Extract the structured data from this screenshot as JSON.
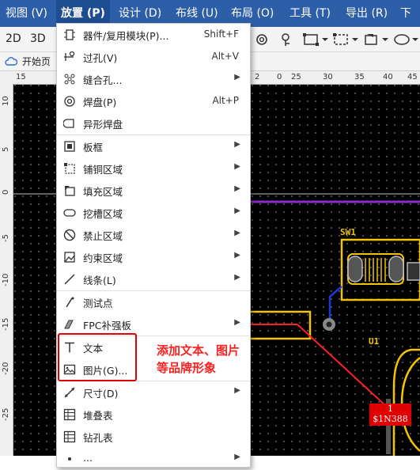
{
  "menubar": {
    "items": [
      "视图 (V)",
      "放置 (P)",
      "设计 (D)",
      "布线 (U)",
      "布局 (O)",
      "工具 (T)",
      "导出 (R)",
      "下"
    ]
  },
  "toolbar": {
    "view2d": "2D",
    "view3d": "3D"
  },
  "tabbar": {
    "home_tab": "开始页"
  },
  "ruler": {
    "top": [
      "15",
      "2",
      "0",
      "25",
      "30",
      "35",
      "40",
      "45"
    ],
    "left": [
      "10",
      "5",
      "0",
      "-5",
      "-10",
      "-15",
      "-20",
      "-25"
    ]
  },
  "menu": {
    "items": [
      {
        "label": "器件/复用模块(P)...",
        "shortcut": "Shift+F",
        "icon": "component-icon"
      },
      {
        "label": "过孔(V)",
        "shortcut": "Alt+V",
        "icon": "via-icon"
      },
      {
        "label": "缝合孔...",
        "arrow": "▶",
        "icon": "stitch-via-icon"
      },
      {
        "label": "焊盘(P)",
        "shortcut": "Alt+P",
        "icon": "pad-icon"
      },
      {
        "label": "异形焊盘",
        "icon": "custom-pad-icon"
      },
      {
        "label": "板框",
        "arrow": "▶",
        "icon": "board-outline-icon"
      },
      {
        "label": "铺铜区域",
        "arrow": "▶",
        "icon": "copper-pour-icon"
      },
      {
        "label": "填充区域",
        "arrow": "▶",
        "icon": "fill-region-icon"
      },
      {
        "label": "挖槽区域",
        "arrow": "▶",
        "icon": "slot-region-icon"
      },
      {
        "label": "禁止区域",
        "arrow": "▶",
        "icon": "keepout-icon"
      },
      {
        "label": "约束区域",
        "arrow": "▶",
        "icon": "constraint-region-icon"
      },
      {
        "label": "线条(L)",
        "arrow": "▶",
        "icon": "line-icon"
      },
      {
        "label": "测试点",
        "icon": "test-point-icon"
      },
      {
        "label": "FPC补强板",
        "arrow": "▶",
        "icon": "fpc-stiffener-icon"
      },
      {
        "label": "文本",
        "icon": "text-icon"
      },
      {
        "label": "图片(G)...",
        "icon": "image-icon"
      },
      {
        "label": "尺寸(D)",
        "arrow": "▶",
        "icon": "dimension-icon"
      },
      {
        "label": "堆叠表",
        "icon": "stackup-table-icon"
      },
      {
        "label": "钻孔表",
        "icon": "drill-table-icon"
      },
      {
        "label": "...",
        "arrow": "▶",
        "icon": "more-icon"
      }
    ]
  },
  "annotation": {
    "line1": "添加文本、图片",
    "line2": "等品牌形象"
  },
  "pcb": {
    "sw_label": "SW1",
    "u_label": "U1",
    "pad_number": "1",
    "pad_net": "$1N388"
  },
  "colors": {
    "menubar": "#2d5fa8",
    "canvas": "#000000",
    "silkscreen": "#f5c400",
    "annotation": "#ff2020",
    "highlight_box": "#e00000",
    "track_blue": "#1a3bd8",
    "track_purple": "#8a2ad0"
  }
}
